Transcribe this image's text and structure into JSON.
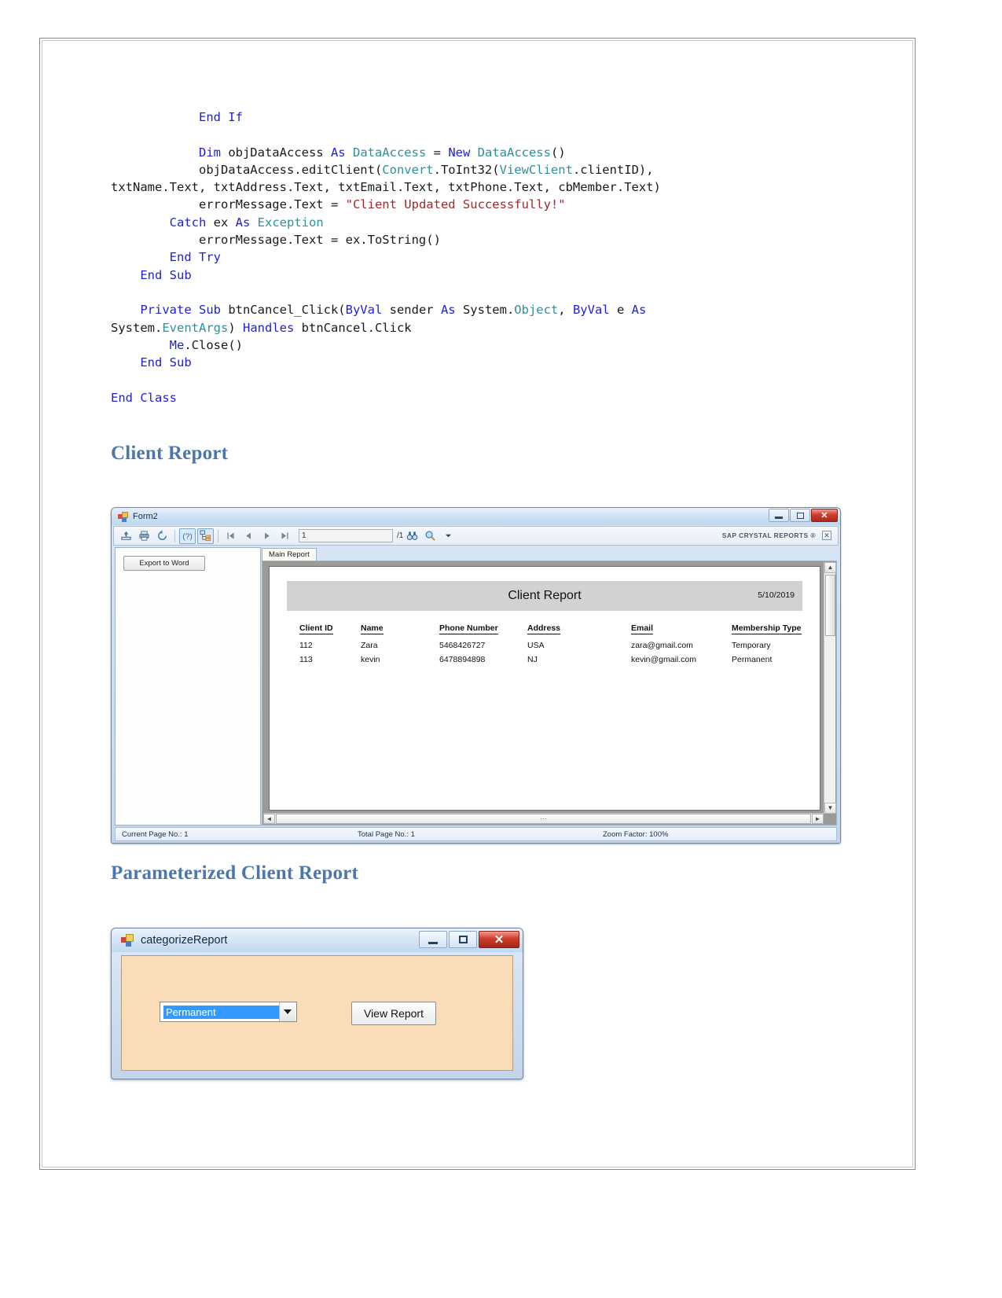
{
  "code": {
    "lines": [
      [
        {
          "t": "            ",
          "c": "pln"
        },
        {
          "t": "End If",
          "c": "kw"
        }
      ],
      [],
      [
        {
          "t": "            ",
          "c": "pln"
        },
        {
          "t": "Dim",
          "c": "kw"
        },
        {
          "t": " objDataAccess ",
          "c": "pln"
        },
        {
          "t": "As",
          "c": "kw"
        },
        {
          "t": " ",
          "c": "pln"
        },
        {
          "t": "DataAccess",
          "c": "typ"
        },
        {
          "t": " = ",
          "c": "pln"
        },
        {
          "t": "New",
          "c": "kw"
        },
        {
          "t": " ",
          "c": "pln"
        },
        {
          "t": "DataAccess",
          "c": "typ"
        },
        {
          "t": "()",
          "c": "pln"
        }
      ],
      [
        {
          "t": "            objDataAccess.editClient(",
          "c": "pln"
        },
        {
          "t": "Convert",
          "c": "typ"
        },
        {
          "t": ".ToInt32(",
          "c": "pln"
        },
        {
          "t": "ViewClient",
          "c": "typ"
        },
        {
          "t": ".clientID),",
          "c": "pln"
        }
      ],
      [
        {
          "t": "txtName.Text, txtAddress.Text, txtEmail.Text, txtPhone.Text, cbMember.Text)",
          "c": "pln"
        }
      ],
      [
        {
          "t": "            errorMessage.Text = ",
          "c": "pln"
        },
        {
          "t": "\"Client Updated Successfully!\"",
          "c": "str"
        }
      ],
      [
        {
          "t": "        ",
          "c": "pln"
        },
        {
          "t": "Catch",
          "c": "kw"
        },
        {
          "t": " ex ",
          "c": "pln"
        },
        {
          "t": "As",
          "c": "kw"
        },
        {
          "t": " ",
          "c": "pln"
        },
        {
          "t": "Exception",
          "c": "typ"
        }
      ],
      [
        {
          "t": "            errorMessage.Text = ex.ToString()",
          "c": "pln"
        }
      ],
      [
        {
          "t": "        ",
          "c": "pln"
        },
        {
          "t": "End Try",
          "c": "kw"
        }
      ],
      [
        {
          "t": "    ",
          "c": "pln"
        },
        {
          "t": "End Sub",
          "c": "kw"
        }
      ],
      [],
      [
        {
          "t": "    ",
          "c": "pln"
        },
        {
          "t": "Private Sub",
          "c": "kw"
        },
        {
          "t": " btnCancel_Click(",
          "c": "pln"
        },
        {
          "t": "ByVal",
          "c": "kw"
        },
        {
          "t": " sender ",
          "c": "pln"
        },
        {
          "t": "As",
          "c": "kw"
        },
        {
          "t": " System.",
          "c": "pln"
        },
        {
          "t": "Object",
          "c": "typ"
        },
        {
          "t": ", ",
          "c": "pln"
        },
        {
          "t": "ByVal",
          "c": "kw"
        },
        {
          "t": " e ",
          "c": "pln"
        },
        {
          "t": "As",
          "c": "kw"
        }
      ],
      [
        {
          "t": "System.",
          "c": "pln"
        },
        {
          "t": "EventArgs",
          "c": "typ"
        },
        {
          "t": ") ",
          "c": "pln"
        },
        {
          "t": "Handles",
          "c": "kw"
        },
        {
          "t": " btnCancel.Click",
          "c": "pln"
        }
      ],
      [
        {
          "t": "        ",
          "c": "pln"
        },
        {
          "t": "Me",
          "c": "kw"
        },
        {
          "t": ".Close()",
          "c": "pln"
        }
      ],
      [
        {
          "t": "    ",
          "c": "pln"
        },
        {
          "t": "End Sub",
          "c": "kw"
        }
      ],
      [],
      [
        {
          "t": "End Class",
          "c": "kw"
        }
      ]
    ]
  },
  "headings": {
    "client_report": "Client Report",
    "parameterized_client_report": "Parameterized Client Report"
  },
  "crystal_window": {
    "title": "Form2",
    "app_icon": "vb-form-icon",
    "window_buttons": {
      "minimize": "minimize-icon",
      "maximize": "maximize-icon",
      "close": "✕"
    },
    "toolbar": {
      "buttons": [
        {
          "name": "export-report-button",
          "icon": "export-icon"
        },
        {
          "name": "print-report-button",
          "icon": "printer-icon"
        },
        {
          "name": "refresh-report-button",
          "icon": "refresh-icon"
        },
        {
          "name": "toggle-help-button",
          "icon": "question-mark-icon"
        },
        {
          "name": "toggle-group-tree-button",
          "icon": "group-tree-icon"
        },
        {
          "name": "first-page-button",
          "icon": "first-page-icon"
        },
        {
          "name": "previous-page-button",
          "icon": "previous-page-icon"
        },
        {
          "name": "next-page-button",
          "icon": "next-page-icon"
        },
        {
          "name": "last-page-button",
          "icon": "last-page-icon"
        }
      ],
      "page_number_value": "1",
      "total_pages_label": "/1",
      "find_icon": "binoculars-icon",
      "zoom_icon": "magnifier-icon",
      "zoom_dropdown_icon": "chevron-down-icon"
    },
    "brand": "SAP CRYSTAL REPORTS ®",
    "brand_close_icon": "✕",
    "left_pane": {
      "export_to_word_label": "Export to Word"
    },
    "tabs": [
      {
        "label": "Main Report"
      }
    ],
    "report": {
      "title": "Client Report",
      "date": "5/10/2019",
      "columns": [
        "Client ID",
        "Name",
        "Phone Number",
        "Address",
        "Email",
        "Membership Type"
      ],
      "rows": [
        [
          "112",
          "Zara",
          "5468426727",
          "USA",
          "zara@gmail.com",
          "Temporary"
        ],
        [
          "113",
          "kevin",
          "6478894898",
          "NJ",
          "kevin@gmail.com",
          "Permanent"
        ]
      ]
    },
    "status_bar": {
      "current_page": "Current Page No.: 1",
      "total_page": "Total Page No.: 1",
      "zoom_factor": "Zoom Factor: 100%"
    }
  },
  "categorize_window": {
    "title": "categorizeReport",
    "app_icon": "vb-form-icon",
    "window_buttons": {
      "minimize": "minimize-icon",
      "maximize": "maximize-icon",
      "close": "✕"
    },
    "membership_combo": {
      "selected": "Permanent",
      "dropdown_icon": "chevron-down-icon"
    },
    "view_report_button": "View Report"
  },
  "colors": {
    "heading": "#4a77ad",
    "code_keyword": "#1f1fd6",
    "code_type": "#2f8f9d",
    "code_string": "#a3282d",
    "dialog_body": "#fbdcb8",
    "combo_selection": "#3399ff"
  }
}
